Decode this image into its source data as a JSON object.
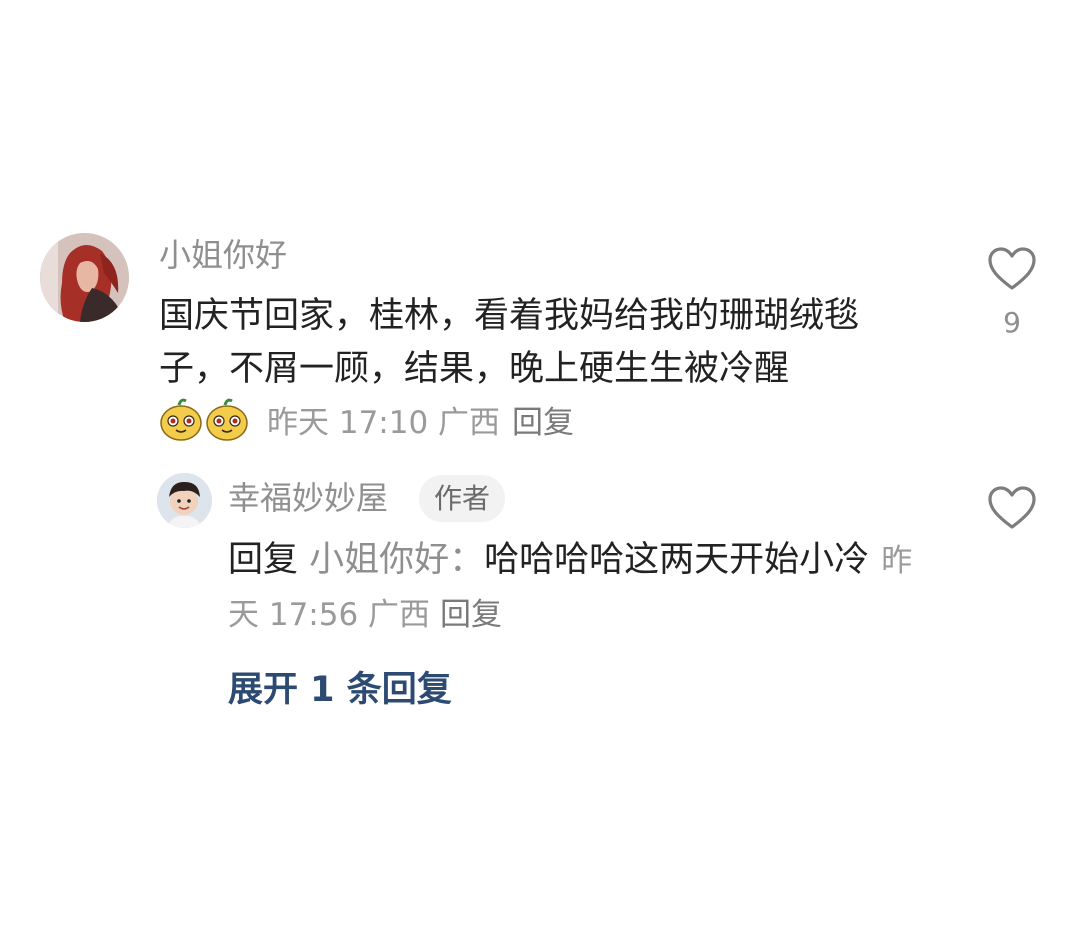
{
  "comment": {
    "username": "小姐你好",
    "text": "国庆节回家，桂林，看着我妈给我的珊瑚绒毯子，不屑一顾，结果，晚上硬生生被冷醒",
    "meta": "昨天 17:10 广西",
    "reply_label": "回复",
    "like_count": "9",
    "like_icon": "heart-outline-icon",
    "sticker_icon": "cartoon-face-sticker"
  },
  "reply": {
    "username": "幸福妙妙屋",
    "badge": "作者",
    "prefix": "回复",
    "reply_to": "小姐你好：",
    "text": "哈哈哈哈这两天开始小冷",
    "meta": "昨天 17:56 广西",
    "reply_label": "回复",
    "like_icon": "heart-outline-icon"
  },
  "expand_label": "展开 1 条回复"
}
